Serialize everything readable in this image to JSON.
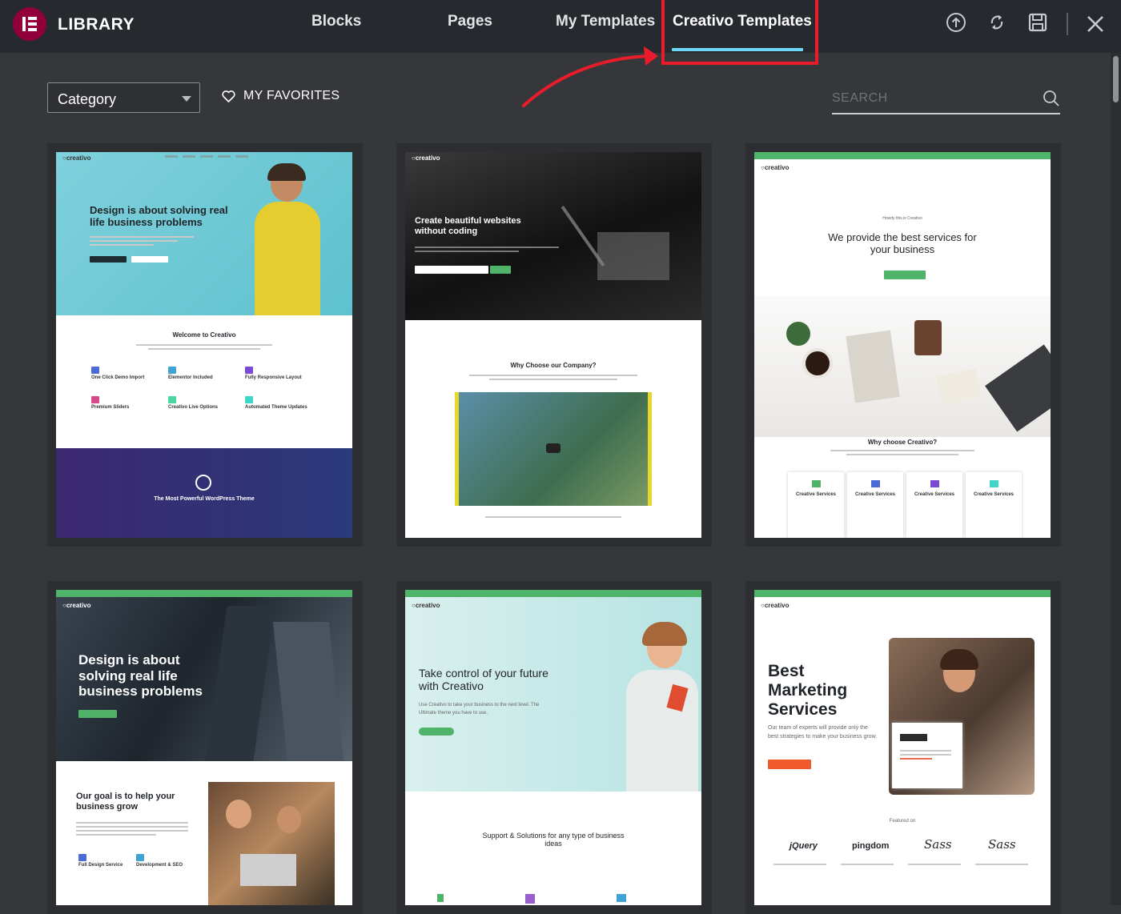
{
  "header": {
    "brand": "LIBRARY",
    "tabs": [
      {
        "label": "Blocks",
        "active": false
      },
      {
        "label": "Pages",
        "active": false
      },
      {
        "label": "My Templates",
        "active": false
      },
      {
        "label": "Creativo Templates",
        "active": true
      }
    ],
    "tools": [
      "upload-icon",
      "sync-icon",
      "save-icon",
      "close-icon"
    ]
  },
  "filters": {
    "category_label": "Category",
    "favorites_label": "MY FAVORITES",
    "search_placeholder": "SEARCH"
  },
  "colors": {
    "accent": "#71d7f7",
    "highlight": "#ea1c2c",
    "brand": "#92003b"
  },
  "templates": [
    {
      "headline": "Design is about solving real life business problems",
      "section_title": "Welcome to Creativo",
      "features": [
        "One Click Demo Import",
        "Elementor Included",
        "Fully Responsive Layout",
        "Premium Sliders",
        "Creativo Live Options",
        "Automated Theme Updates"
      ],
      "footer_title": "The Most Powerful WordPress Theme"
    },
    {
      "headline": "Create beautiful websites without coding",
      "section_title": "Why Choose our Company?"
    },
    {
      "headline": "We provide the best services for your business",
      "section_title": "Why choose Creativo?",
      "services": [
        "Creative Services",
        "Creative Services",
        "Creative Services",
        "Creative Services"
      ]
    },
    {
      "headline": "Design is about solving real life business problems",
      "section_title": "Our goal is to help your business grow",
      "features": [
        "Full Design Service",
        "Development & SEO"
      ]
    },
    {
      "headline": "Take control of your future with Creativo",
      "subtext": "Use Creativo to take your business to the next level. The Ultimate theme you have to use.",
      "section_title": "Support & Solutions for any type of business ideas"
    },
    {
      "headline": "Best Marketing Services",
      "subtext": "Our team of experts will provide only the best strategies to make your business grow.",
      "featured_label": "Featured on",
      "brands": [
        "jQuery",
        "pingdom",
        "Sass",
        "Sass"
      ]
    }
  ]
}
